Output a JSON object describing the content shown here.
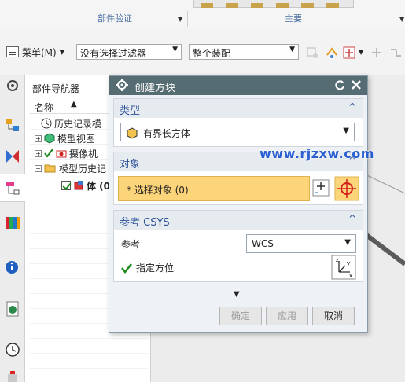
{
  "ribbon": {
    "group1_label": "部件验证",
    "group2_label": "主要"
  },
  "toolbar": {
    "menu_label": "菜单(M)",
    "filter_value": "没有选择过滤器",
    "assembly_value": "整个装配"
  },
  "navigator": {
    "title": "部件导航器",
    "column_name": "名称",
    "items": [
      {
        "label": "历史记录模"
      },
      {
        "label": "模型视图"
      },
      {
        "label": "摄像机"
      },
      {
        "label": "模型历史记"
      },
      {
        "label": "体 (0"
      }
    ]
  },
  "dialog": {
    "title": "创建方块",
    "type_section": "类型",
    "type_value": "有界长方体",
    "object_section": "对象",
    "select_object": "* 选择对象 (0)",
    "csys_section": "参考 CSYS",
    "reference_label": "参考",
    "reference_value": "WCS",
    "orient_label": "指定方位",
    "ok": "确定",
    "apply": "应用",
    "cancel": "取消"
  },
  "watermark": "www.rjzxw.com",
  "colors": {
    "title_bar": "#556c73",
    "section_text": "#2a4f96",
    "selection_highlight": "#fcd57a",
    "check_green": "#1a8a1a",
    "required_red": "#d21d1d"
  }
}
